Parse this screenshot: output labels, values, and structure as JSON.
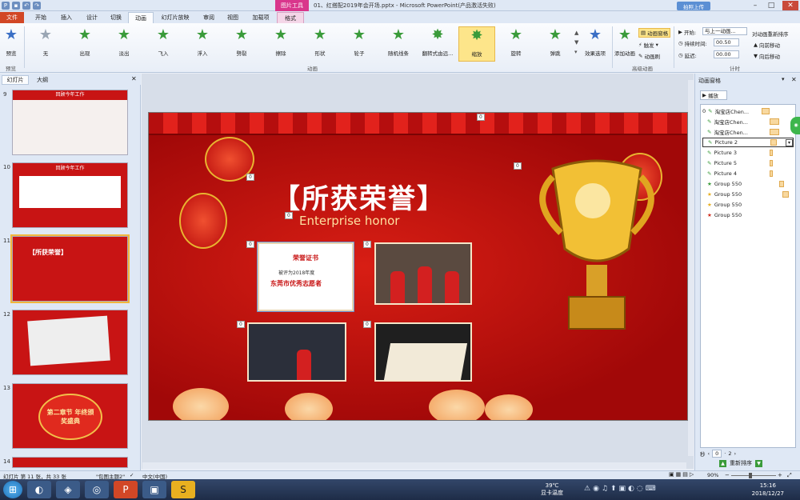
{
  "window": {
    "title": "01、红搭配2019年会开场.pptx - Microsoft PowerPoint(产品激活失败)",
    "context_tab": "图片工具",
    "upload_button": "拍照上传"
  },
  "tabs": [
    "文件",
    "开始",
    "插入",
    "设计",
    "切换",
    "动画",
    "幻灯片放映",
    "审阅",
    "视图",
    "加载项",
    "格式"
  ],
  "ribbon": {
    "preview_label": "预览",
    "preview_group": "预览",
    "animations": [
      "无",
      "出现",
      "淡出",
      "飞入",
      "浮入",
      "劈裂",
      "擦除",
      "形状",
      "轮子",
      "随机线条",
      "翻转式由远...",
      "缩放",
      "旋转",
      "弹跳"
    ],
    "selected_animation": "缩放",
    "effect_options": "效果选项",
    "animation_group": "动画",
    "add_animation": "添加动画",
    "animation_pane": "动画窗格",
    "trigger": "触发",
    "animation_painter": "动画刷",
    "advanced_group": "高级动画",
    "start_label": "开始:",
    "start_value": "与上一动画...",
    "duration_label": "持续时间:",
    "duration_value": "00.50",
    "delay_label": "延迟:",
    "delay_value": "00.00",
    "reorder_title": "对动画重新排序",
    "move_earlier": "向前移动",
    "move_later": "向后移动",
    "timing_group": "计时"
  },
  "left_panel": {
    "tab_slides": "幻灯片",
    "tab_outline": "大纲",
    "slides": [
      {
        "num": "9",
        "title": "回顾今年工作"
      },
      {
        "num": "10",
        "title": "回顾今年工作"
      },
      {
        "num": "11",
        "title": "【所获荣誉】"
      },
      {
        "num": "12",
        "title": ""
      },
      {
        "num": "13",
        "title": "第二章节 年终颁奖盛典"
      },
      {
        "num": "14",
        "title": ""
      }
    ]
  },
  "slide": {
    "title": "【所获荣誉】",
    "subtitle": "Enterprise honor",
    "certificate_title": "荣誉证书",
    "certificate_line1": "被评为2018年度",
    "certificate_line2": "东莞市优秀志愿者",
    "badge": "0"
  },
  "animation_pane": {
    "title": "动画窗格",
    "play_button": "播放",
    "items": [
      {
        "num": "0",
        "name": "淘宝店Chen...",
        "icon": "wand"
      },
      {
        "num": "",
        "name": "淘宝店Chen...",
        "icon": "wand"
      },
      {
        "num": "",
        "name": "淘宝店Chen...",
        "icon": "wand"
      },
      {
        "num": "",
        "name": "Picture 2",
        "icon": "wand"
      },
      {
        "num": "",
        "name": "Picture 3",
        "icon": "wand"
      },
      {
        "num": "",
        "name": "Picture 5",
        "icon": "wand"
      },
      {
        "num": "",
        "name": "Picture 4",
        "icon": "wand"
      },
      {
        "num": "",
        "name": "Group 550",
        "icon": "star-green"
      },
      {
        "num": "",
        "name": "Group 550",
        "icon": "star-yellow"
      },
      {
        "num": "",
        "name": "Group 550",
        "icon": "star-yellow"
      },
      {
        "num": "",
        "name": "Group 550",
        "icon": "star-red"
      }
    ],
    "seconds_label": "秒",
    "seconds_values": [
      "0",
      "2"
    ],
    "reorder_label": "重新排序"
  },
  "status": {
    "slide_info": "幻灯片 第 11 张，共 33 张",
    "theme": "\"包图主题2\"",
    "language": "中文(中国)",
    "zoom": "90%"
  },
  "taskbar": {
    "weather_temp": "39℃",
    "weather_text": "显卡温度",
    "time": "15:16",
    "date": "2018/12/27"
  }
}
